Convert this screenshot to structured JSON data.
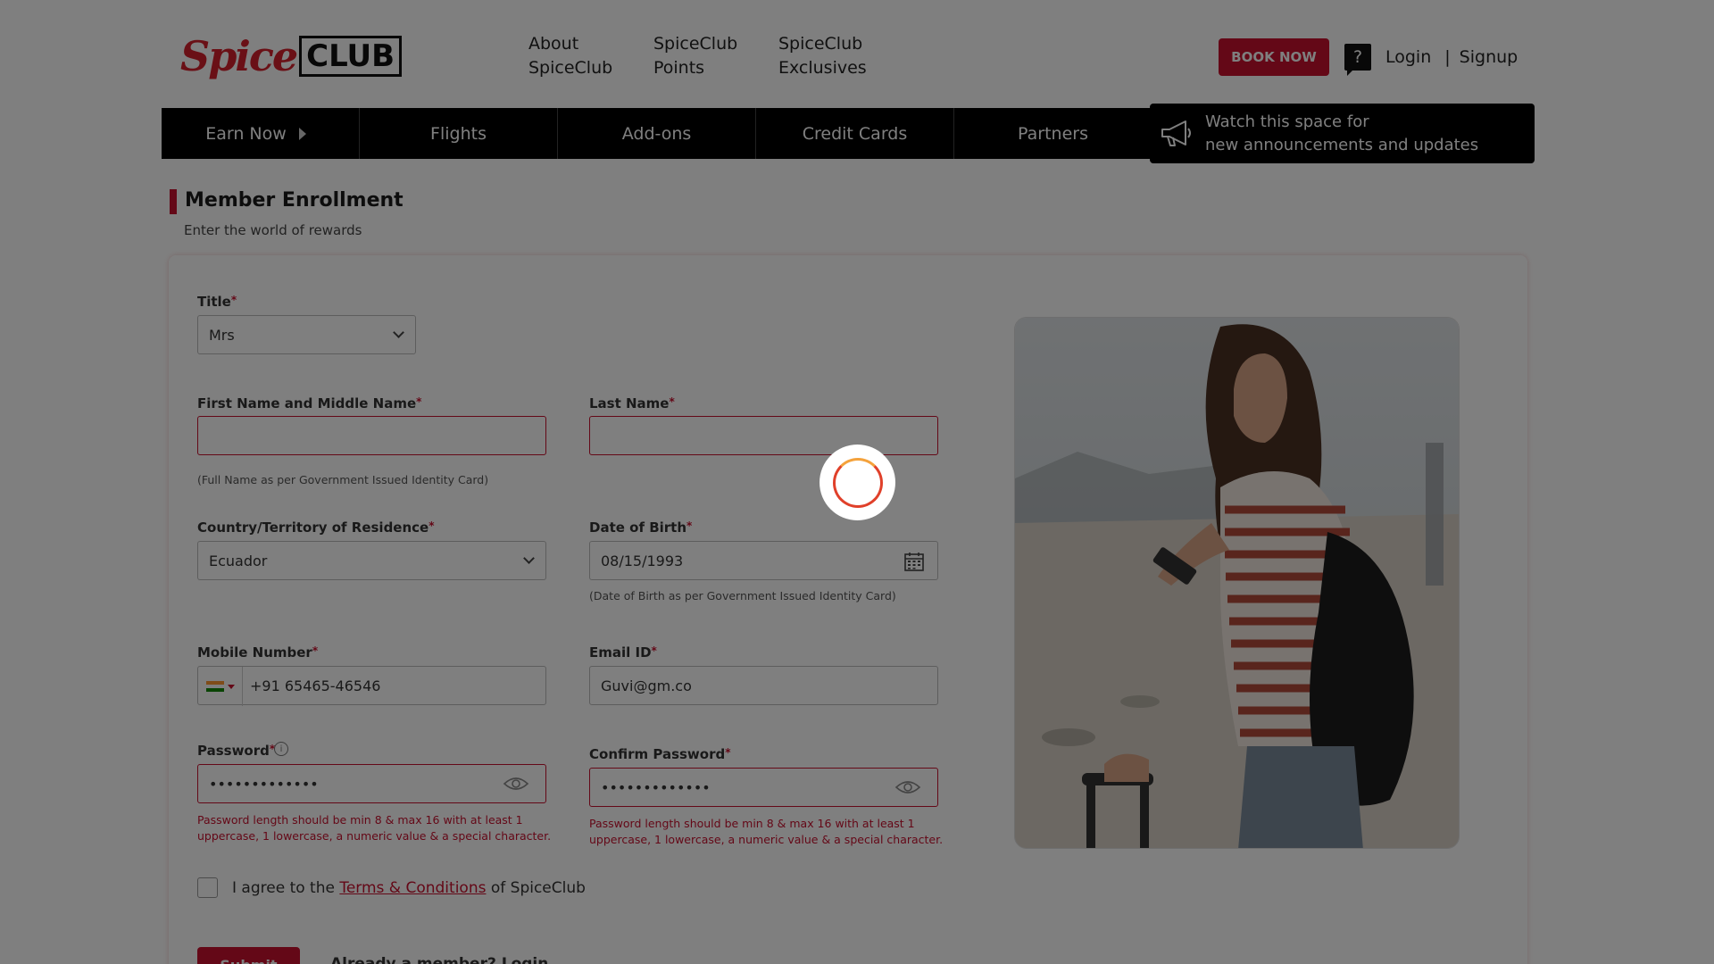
{
  "header": {
    "logo_spice": "Spice",
    "logo_club": "CLUB",
    "nav": [
      {
        "line1": "About",
        "line2": "SpiceClub"
      },
      {
        "line1": "SpiceClub",
        "line2": "Points"
      },
      {
        "line1": "SpiceClub",
        "line2": "Exclusives"
      }
    ],
    "book_now": "BOOK NOW",
    "help_icon": "?",
    "login": "Login",
    "separator": "|",
    "signup": "Signup"
  },
  "mainnav": {
    "items": [
      "Earn Now",
      "Flights",
      "Add-ons",
      "Credit Cards",
      "Partners"
    ],
    "announcement_line1": "Watch this space for",
    "announcement_line2": "new announcements and updates"
  },
  "page": {
    "title": "Member Enrollment",
    "subtitle": "Enter the world of rewards"
  },
  "form": {
    "title_label": "Title",
    "title_value": "Mrs",
    "first_name_label": "First Name and Middle Name",
    "first_name_value": "",
    "last_name_label": "Last Name",
    "last_name_value": "",
    "name_hint": "(Full Name as per Government Issued Identity Card)",
    "country_label": "Country/Territory of Residence",
    "country_value": "Ecuador",
    "dob_label": "Date of Birth",
    "dob_value": "08/15/1993",
    "dob_hint": "(Date of Birth as per Government Issued Identity Card)",
    "mobile_label": "Mobile Number",
    "mobile_value": "+91 65465-46546",
    "email_label": "Email ID",
    "email_value": "Guvi@gm.co",
    "password_label": "Password",
    "password_value": "•••••••••••••",
    "confirm_password_label": "Confirm Password",
    "confirm_password_value": "•••••••••••••",
    "password_error": "Password length should be min 8 & max 16 with at least 1 uppercase, 1 lowercase, a numeric value & a special character.",
    "required_mark": "*",
    "info_icon": "i",
    "agree_prefix": "I agree to the ",
    "terms_link": "Terms & Conditions",
    "agree_suffix": " of SpiceClub",
    "submit": "Submit",
    "already_member": "Already a member? Login"
  },
  "icons": [
    "megaphone-icon",
    "help-icon",
    "calendar-icon",
    "eye-icon",
    "info-icon",
    "chevron-down-icon",
    "flag-icon",
    "spinner-icon"
  ],
  "colors": {
    "brand_red": "#c8102e",
    "nav_black": "#000000",
    "overlay": "rgba(0,0,0,0.5)"
  },
  "state": {
    "loading": true
  }
}
